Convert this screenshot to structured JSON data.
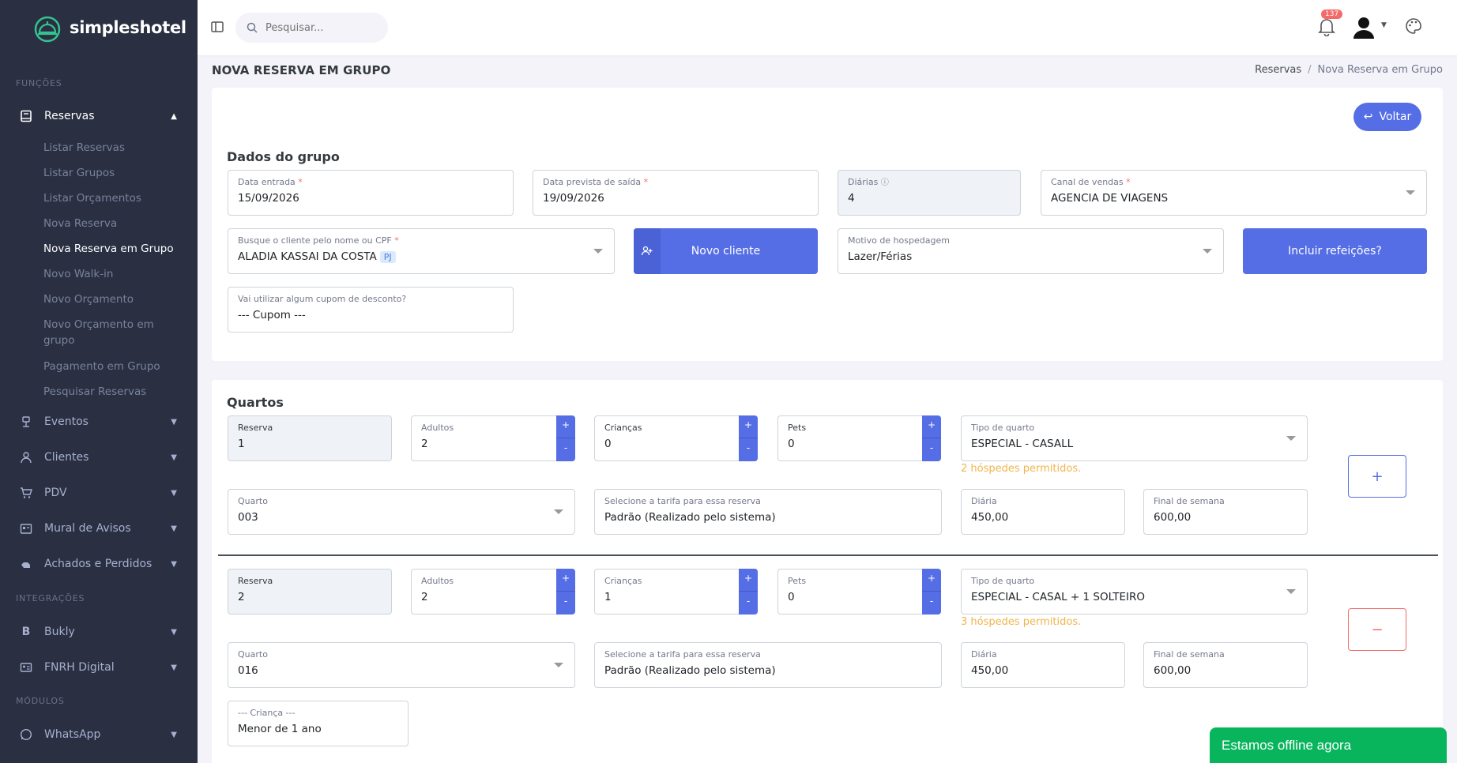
{
  "app": {
    "logo_text": "simpleshotel"
  },
  "search": {
    "placeholder": "Pesquisar..."
  },
  "topbar": {
    "notification_count": "137"
  },
  "sidebar": {
    "sections": {
      "funcoes": "FUNÇÕES",
      "integracoes": "INTEGRAÇÕES",
      "modulos": "MÓDULOS"
    },
    "reservas": {
      "label": "Reservas",
      "subitems": [
        "Listar Reservas",
        "Listar Grupos",
        "Listar Orçamentos",
        "Nova Reserva",
        "Nova Reserva em Grupo",
        "Novo Walk-in",
        "Novo Orçamento",
        "Novo Orçamento em grupo",
        "Pagamento em Grupo",
        "Pesquisar Reservas"
      ]
    },
    "items": {
      "eventos": "Eventos",
      "clientes": "Clientes",
      "pdv": "PDV",
      "mural": "Mural de Avisos",
      "achados": "Achados e Perdidos",
      "bukly": "Bukly",
      "fnrh": "FNRH Digital",
      "whatsapp": "WhatsApp"
    }
  },
  "page": {
    "title": "NOVA RESERVA EM GRUPO",
    "breadcrumb": [
      "Reservas",
      "Nova Reserva em Grupo"
    ],
    "back_button": "Voltar"
  },
  "group": {
    "section_title": "Dados do grupo",
    "data_entrada": {
      "label": "Data entrada",
      "value": "15/09/2026"
    },
    "data_saida": {
      "label": "Data prevista de saída",
      "value": "19/09/2026"
    },
    "diarias": {
      "label": "Diárias",
      "value": "4"
    },
    "canal": {
      "label": "Canal de vendas",
      "value": "AGENCIA DE VIAGENS"
    },
    "cliente": {
      "label": "Busque o cliente pelo nome ou CPF",
      "value": "ALADIA KASSAI DA COSTA",
      "tag": "PJ"
    },
    "novo_cliente_button": "Novo cliente",
    "motivo": {
      "label": "Motivo de hospedagem",
      "value": "Lazer/Férias"
    },
    "refeicoes_button": "Incluir refeições?",
    "cupom": {
      "label": "Vai utilizar algum cupom de desconto?",
      "value": "--- Cupom ---"
    }
  },
  "rooms": {
    "section_title": "Quartos",
    "labels": {
      "reserva": "Reserva",
      "adultos": "Adultos",
      "criancas": "Crianças",
      "pets": "Pets",
      "tipo": "Tipo de quarto",
      "quarto": "Quarto",
      "tarifa": "Selecione a tarifa para essa reserva",
      "diaria": "Diária",
      "fim_semana": "Final de semana"
    },
    "list": [
      {
        "reserva": "1",
        "adultos": "2",
        "criancas": "0",
        "pets": "0",
        "tipo": "ESPECIAL - CASALL",
        "hint": "2 hóspedes permitidos.",
        "quarto": "003",
        "tarifa": "Padrão (Realizado pelo sistema)",
        "diaria": "450,00",
        "fim_semana": "600,00"
      },
      {
        "reserva": "2",
        "adultos": "2",
        "criancas": "1",
        "pets": "0",
        "tipo": "ESPECIAL - CASAL + 1 SOLTEIRO",
        "hint": "3 hóspedes permitidos.",
        "quarto": "016",
        "tarifa": "Padrão (Realizado pelo sistema)",
        "diaria": "450,00",
        "fim_semana": "600,00",
        "crianca_field": {
          "label": "--- Criança ---",
          "value": "Menor de 1 ano"
        }
      }
    ],
    "add_button": "+",
    "remove_button": "−"
  },
  "chat": {
    "offline_text": "Estamos offline agora"
  },
  "colors": {
    "primary": "#556ee6",
    "sidebar": "#2a3042",
    "danger": "#f46a6a",
    "warning": "#f1b44c",
    "chat": "#08b55d"
  }
}
